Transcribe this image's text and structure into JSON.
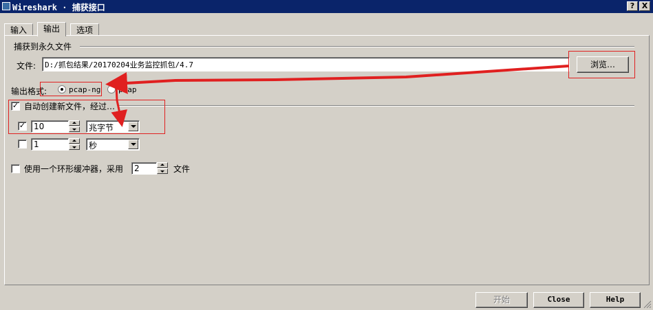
{
  "window": {
    "title": "Wireshark · 捕获接口",
    "help_btn": "?",
    "close_btn": "X"
  },
  "tabs": [
    {
      "label": "输入"
    },
    {
      "label": "输出"
    },
    {
      "label": "选项"
    }
  ],
  "capture_file": {
    "group_title": "捕获到永久文件",
    "file_label": "文件:",
    "file_value": "D:/抓包结果/20170204业务监控抓包/4.7",
    "browse_label": "浏览…"
  },
  "output_format": {
    "label": "输出格式:",
    "options": [
      {
        "label": "pcap-ng",
        "selected": true
      },
      {
        "label": "pcap",
        "selected": false
      }
    ]
  },
  "auto_new_file": {
    "label": "自动创建新文件，经过…",
    "checked": true,
    "size_rule": {
      "checked": true,
      "value": "10",
      "unit": "兆字节"
    },
    "time_rule": {
      "checked": false,
      "value": "1",
      "unit": "秒"
    }
  },
  "ring_buffer": {
    "label": "使用一个环形缓冲器，采用",
    "checked": false,
    "value": "2",
    "suffix": "文件"
  },
  "footer": {
    "start_label": "开始",
    "close_label": "Close",
    "help_label": "Help"
  },
  "colors": {
    "titlebar": "#0a246a",
    "face": "#d4d0c8",
    "annotation": "#e02020"
  }
}
